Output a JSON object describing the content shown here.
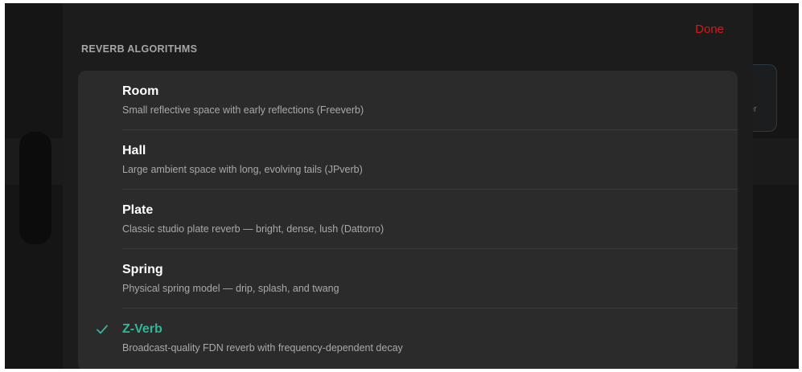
{
  "header": {
    "done_label": "Done",
    "section_title": "REVERB ALGORITHMS"
  },
  "background": {
    "card_text": "er"
  },
  "algorithms": [
    {
      "name": "Room",
      "description": "Small reflective space with early reflections (Freeverb)",
      "selected": false
    },
    {
      "name": "Hall",
      "description": "Large ambient space with long, evolving tails (JPverb)",
      "selected": false
    },
    {
      "name": "Plate",
      "description": "Classic studio plate reverb — bright, dense, lush (Dattorro)",
      "selected": false
    },
    {
      "name": "Spring",
      "description": "Physical spring model — drip, splash, and twang",
      "selected": false
    },
    {
      "name": "Z-Verb",
      "description": "Broadcast-quality FDN reverb with frequency-dependent decay",
      "selected": true
    }
  ],
  "colors": {
    "done": "#d7191a",
    "selected_accent": "#2fb89a",
    "sheet_bg": "#1c1c1c",
    "list_bg": "#2b2b2b"
  },
  "icons": {
    "selected_marker": "checkmark-icon"
  }
}
